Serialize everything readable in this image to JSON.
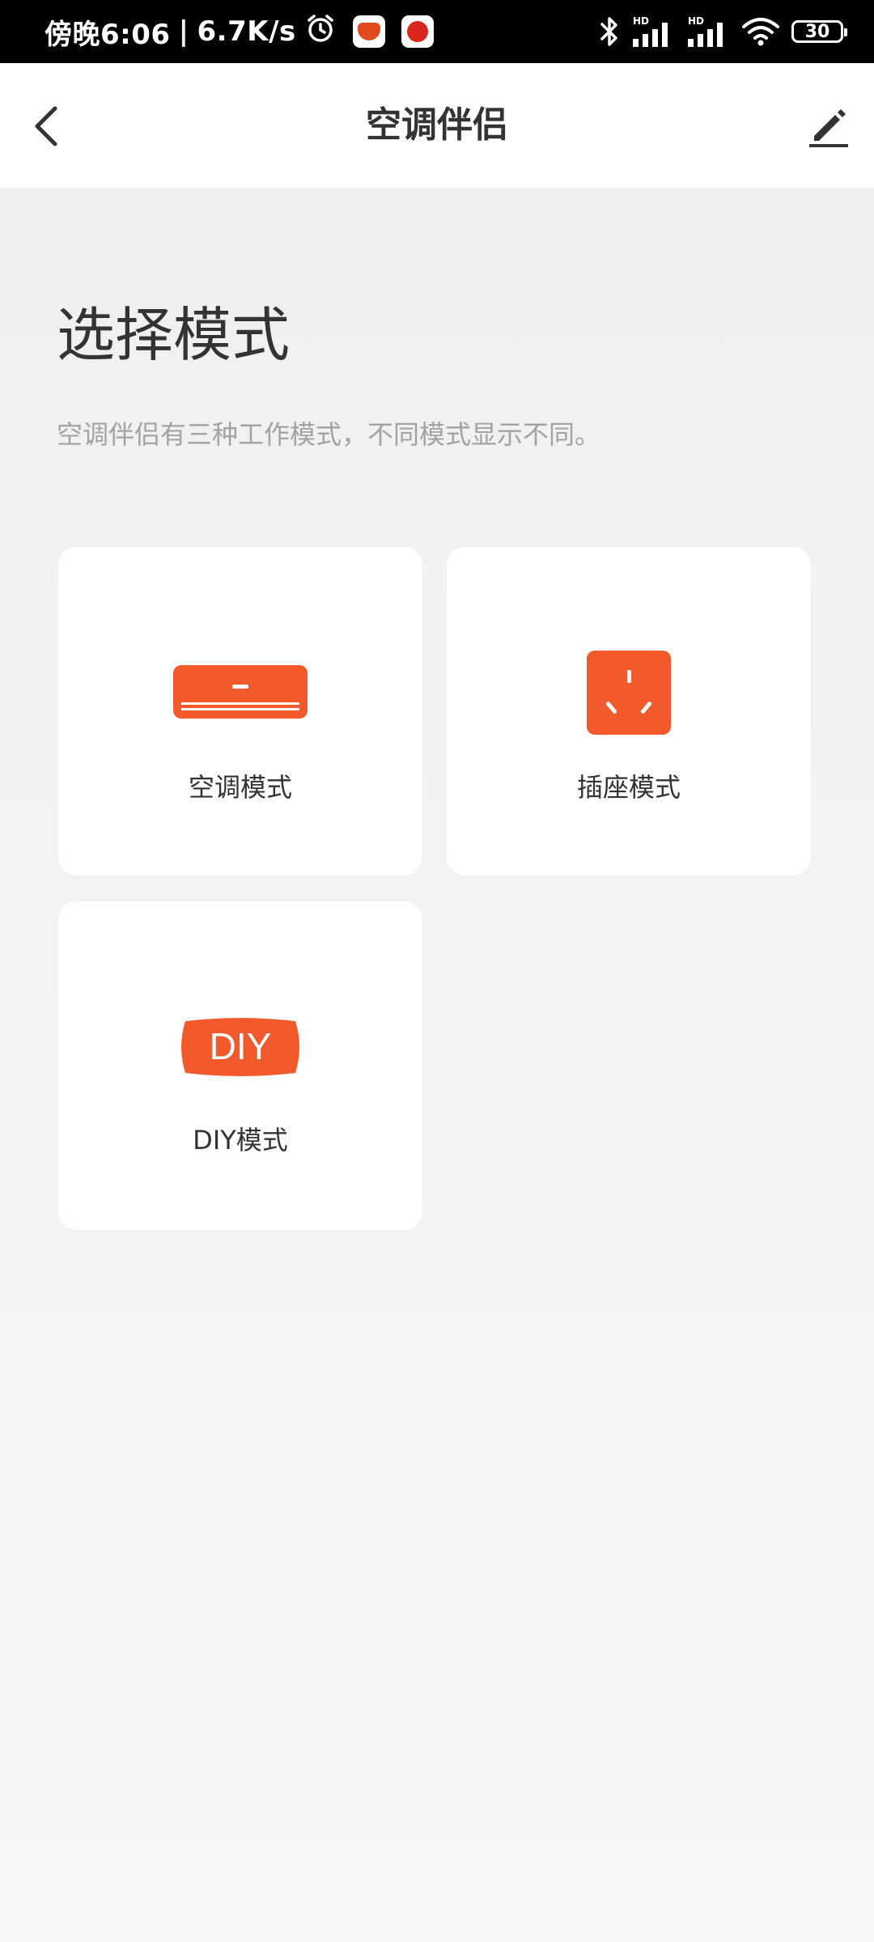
{
  "status_bar": {
    "time_text": "傍晚6:06",
    "separator": "|",
    "network_speed": "6.7K/s",
    "battery_level": "30",
    "icons": [
      "alarm-icon",
      "app-notification-icon",
      "app-notification-icon",
      "bluetooth-icon",
      "hd-signal-icon",
      "hd-signal-icon",
      "wifi-icon",
      "battery-icon"
    ]
  },
  "header": {
    "title": "空调伴侣",
    "back_icon": "chevron-left-icon",
    "edit_icon": "edit-pencil-icon"
  },
  "content": {
    "heading": "选择模式",
    "description": "空调伴侣有三种工作模式，不同模式显示不同。"
  },
  "modes": [
    {
      "label": "空调模式",
      "icon": "air-conditioner-icon"
    },
    {
      "label": "插座模式",
      "icon": "power-socket-icon"
    },
    {
      "label": "DIY模式",
      "icon": "diy-badge-icon",
      "icon_text": "DIY"
    }
  ],
  "colors": {
    "accent": "#f25a2c",
    "status_bar_bg": "#000000",
    "header_bg": "#ffffff",
    "page_bg": "#f2f2f2",
    "card_bg": "#ffffff",
    "title_text": "#333333",
    "desc_text": "#a3a3a3"
  }
}
